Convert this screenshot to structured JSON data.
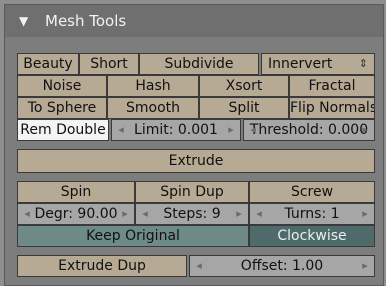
{
  "panel": {
    "title": "Mesh Tools",
    "collapse_icon": "triangle-down-icon"
  },
  "row1": {
    "beauty": "Beauty",
    "short": "Short",
    "subdivide": "Subdivide",
    "dropdown_value": "Innervert",
    "dropdown_icon": "updown-chevron-icon"
  },
  "row2": {
    "noise": "Noise",
    "hash": "Hash",
    "xsort": "Xsort",
    "fractal": "Fractal"
  },
  "row3": {
    "to_sphere": "To Sphere",
    "smooth": "Smooth",
    "split": "Split",
    "flip_normals": "Flip Normals"
  },
  "row4": {
    "rem_double": "Rem Double",
    "limit": "Limit: 0.001",
    "threshold": "Threshold: 0.000"
  },
  "extrude": "Extrude",
  "spin_row": {
    "spin": "Spin",
    "spin_dup": "Spin Dup",
    "screw": "Screw"
  },
  "params_row": {
    "degr": "Degr: 90.00",
    "steps": "Steps: 9",
    "turns": "Turns: 1"
  },
  "keep_row": {
    "keep_original": "Keep Original",
    "clockwise": "Clockwise"
  },
  "bottom": {
    "extrude_dup": "Extrude Dup",
    "offset": "Offset: 1.00"
  }
}
